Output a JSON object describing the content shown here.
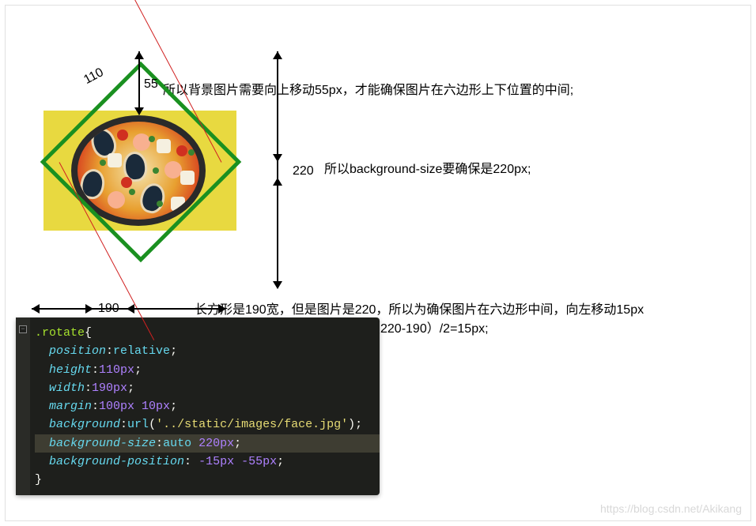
{
  "labels": {
    "l110": "110",
    "l55": "55",
    "l220": "220",
    "l190": "190"
  },
  "text": {
    "line1": "所以背景图片需要向上移动55px，才能确保图片在六边形上下位置的中间;",
    "line2": "所以background-size要确保是220px;",
    "line3a": "长方形是190宽，但是图片是220，所以为确保图片在六边形中间，向左移动15px",
    "line3b": "（220-190）/2=15px;"
  },
  "code": {
    "selector": ".rotate",
    "lbrace": "{",
    "rbrace": "}",
    "l1_prop": "position",
    "l1_val": "relative",
    "l2_prop": "height",
    "l2_val": "110px",
    "l3_prop": "width",
    "l3_val": "190px",
    "l4_prop": "margin",
    "l4_val": "100px 10px",
    "l5_prop": "background",
    "l5_func": "url",
    "l5_str": "'../static/images/face.jpg'",
    "l6_prop": "background-size",
    "l6_kw": "auto",
    "l6_val": "220px",
    "l7_prop": "background-position",
    "l7_val": " -15px -55px",
    "colon": ":",
    "semi": ";",
    "lparen": "(",
    "rparen": ")"
  },
  "watermark": "https://blog.csdn.net/Akikang"
}
